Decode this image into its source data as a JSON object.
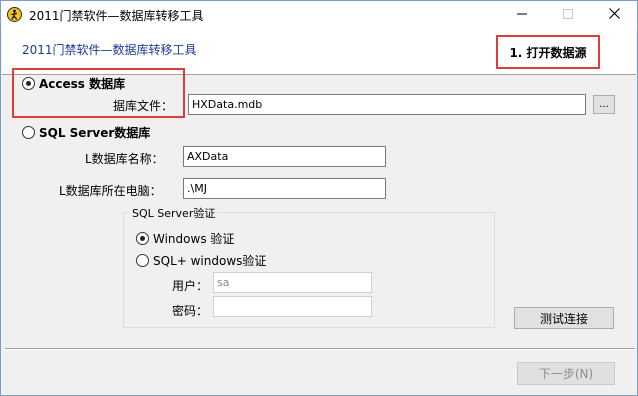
{
  "window": {
    "title": "2011门禁软件—数据库转移工具",
    "icon": "person-walking-icon",
    "controls": {
      "minimize": "minimize-icon",
      "maximize": "maximize-icon",
      "close": "close-icon"
    }
  },
  "header": {
    "title": "2011门禁软件—数据库转移工具",
    "step_label": "1. 打开数据源"
  },
  "access": {
    "radio_label": "Access 数据库",
    "checked": true,
    "file_label": "据库文件：",
    "file_value": "HXData.mdb",
    "browse_label": "..."
  },
  "sql": {
    "radio_label": "SQL Server数据库",
    "checked": false,
    "dbname_label": "L数据库名称：",
    "dbname_value": "AXData",
    "server_label": "L数据库所在电脑：",
    "server_value": ".\\MJ"
  },
  "auth": {
    "group_label": "SQL Server验证",
    "windows_label": "Windows 验证",
    "windows_checked": true,
    "sql_label": "SQL+ windows验证",
    "sql_checked": false,
    "user_label": "用户：",
    "user_value": "sa",
    "password_label": "密码：",
    "password_value": ""
  },
  "buttons": {
    "test_label": "测试连接",
    "next_label": "下一步(N)"
  },
  "colors": {
    "highlight_red": "#e03c3c",
    "header_title_blue": "#1c3a96"
  }
}
